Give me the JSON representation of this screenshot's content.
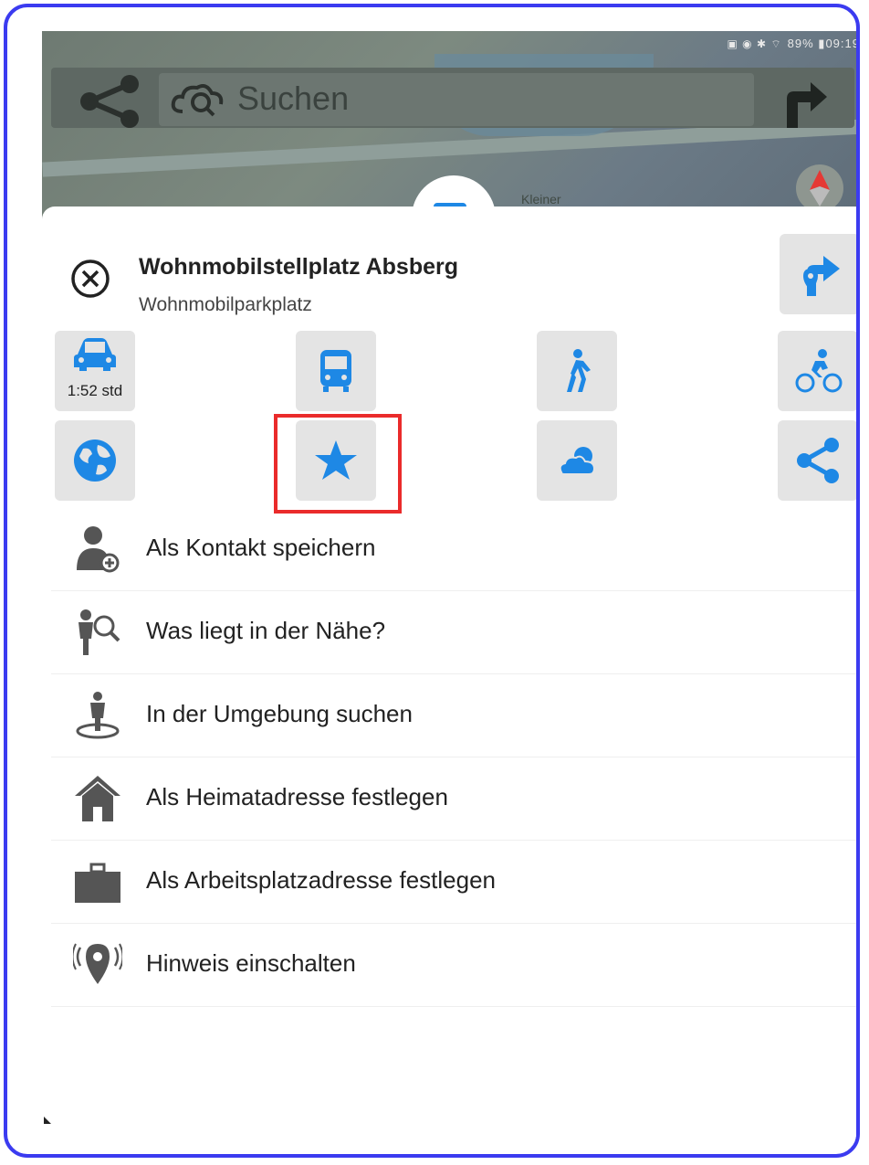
{
  "status_bar": {
    "battery": "89%",
    "time": "09:19"
  },
  "search": {
    "placeholder": "Suchen"
  },
  "map": {
    "label": "Kleiner"
  },
  "place": {
    "title": "Wohnmobilstellplatz Absberg",
    "subtitle": "Wohnmobilparkplatz"
  },
  "transport": {
    "car_time": "1:52 std"
  },
  "menu": {
    "items": [
      {
        "label": "Als Kontakt speichern",
        "icon": "add-contact-icon"
      },
      {
        "label": "Was liegt in der Nähe?",
        "icon": "nearby-search-icon"
      },
      {
        "label": "In der Umgebung suchen",
        "icon": "search-around-icon"
      },
      {
        "label": "Als Heimatadresse festlegen",
        "icon": "home-icon"
      },
      {
        "label": "Als Arbeitsplatzadresse festlegen",
        "icon": "briefcase-icon"
      },
      {
        "label": "Hinweis einschalten",
        "icon": "location-alert-icon"
      }
    ]
  },
  "colors": {
    "accent": "#1e88e5",
    "highlight": "#ea2b2b",
    "frame": "#3b3bf0"
  }
}
